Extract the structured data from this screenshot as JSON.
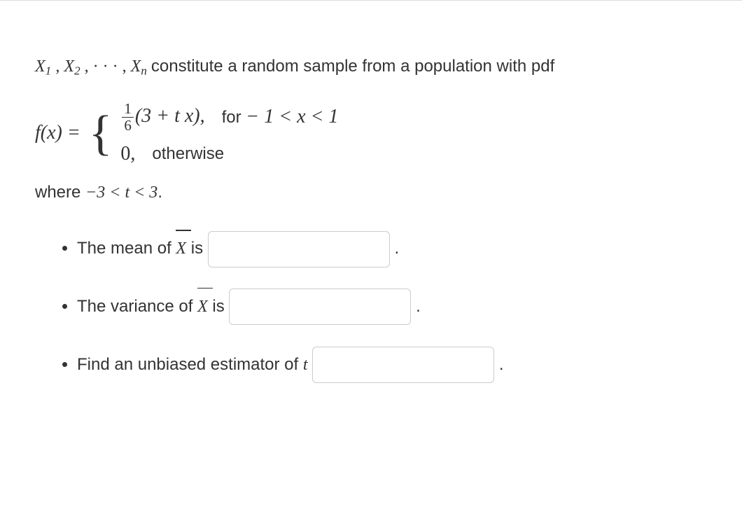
{
  "intro": {
    "var_seq_pre": "X",
    "sub1": "1",
    "sub2": "2",
    "subn": "n",
    "text_tail": " constitute a random sample from a population with pdf"
  },
  "pdf": {
    "lhs": "f(x) = ",
    "frac_num": "1",
    "frac_den": "6",
    "case1_expr": "(3 + t x),",
    "case1_cond_for": "for ",
    "case1_cond_math": " − 1 < x < 1",
    "case2_expr": "0,",
    "case2_cond": "otherwise"
  },
  "where": {
    "prefix": "where ",
    "math": "−3 < t < 3",
    "period": "."
  },
  "q1": {
    "pre": "The mean of ",
    "xbar": "X",
    "post": " is ",
    "period": "."
  },
  "q2": {
    "pre": "The variance of ",
    "xbar": "X",
    "post": " is ",
    "period": "."
  },
  "q3": {
    "pre": "Find an unbiased estimator of ",
    "t": "t",
    "space": " ",
    "period": "."
  }
}
